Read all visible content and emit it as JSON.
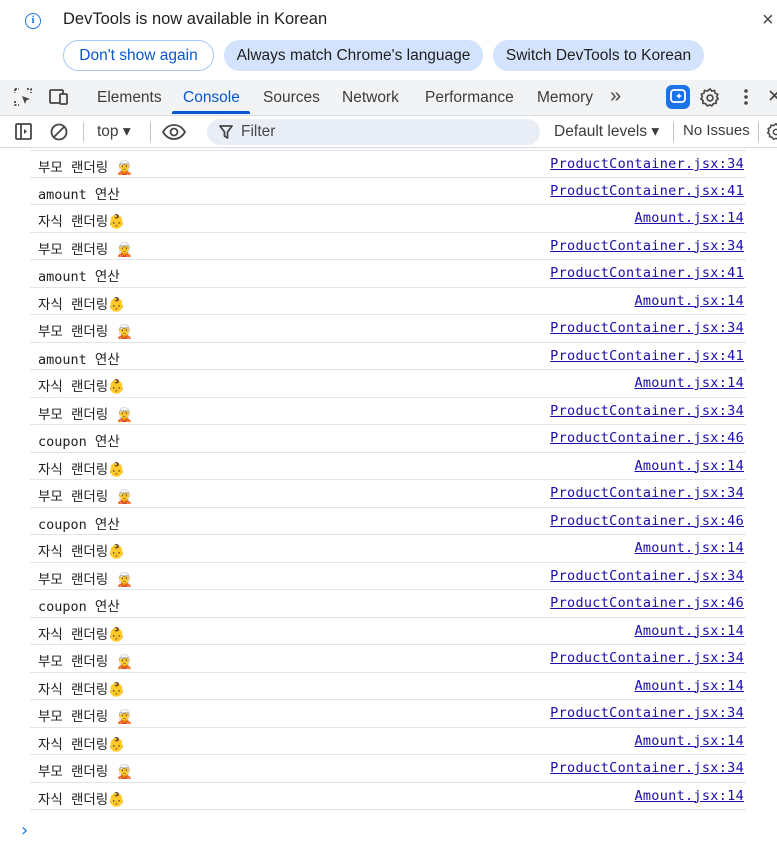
{
  "infobar": {
    "message": "DevTools is now available in Korean",
    "close_glyph": "×",
    "buttons": [
      "Don't show again",
      "Always match Chrome's language",
      "Switch DevTools to Korean"
    ]
  },
  "tabs": {
    "items": [
      "Elements",
      "Console",
      "Sources",
      "Network",
      "Performance",
      "Memory"
    ],
    "active": "Console",
    "more_glyph": "»"
  },
  "toolbar": {
    "context": "top ▾",
    "filter_placeholder": "Filter",
    "levels": "Default levels ▾",
    "issues": "No Issues"
  },
  "console": {
    "rows": [
      {
        "message": "부모 랜더링 🧝",
        "source": "ProductContainer.jsx:34"
      },
      {
        "message": "amount 연산",
        "source": "ProductContainer.jsx:41"
      },
      {
        "message": "자식 랜더링👶",
        "source": "Amount.jsx:14"
      },
      {
        "message": "부모 랜더링 🧝",
        "source": "ProductContainer.jsx:34"
      },
      {
        "message": "amount 연산",
        "source": "ProductContainer.jsx:41"
      },
      {
        "message": "자식 랜더링👶",
        "source": "Amount.jsx:14"
      },
      {
        "message": "부모 랜더링 🧝",
        "source": "ProductContainer.jsx:34"
      },
      {
        "message": "amount 연산",
        "source": "ProductContainer.jsx:41"
      },
      {
        "message": "자식 랜더링👶",
        "source": "Amount.jsx:14"
      },
      {
        "message": "부모 랜더링 🧝",
        "source": "ProductContainer.jsx:34"
      },
      {
        "message": "coupon 연산",
        "source": "ProductContainer.jsx:46"
      },
      {
        "message": "자식 랜더링👶",
        "source": "Amount.jsx:14"
      },
      {
        "message": "부모 랜더링 🧝",
        "source": "ProductContainer.jsx:34"
      },
      {
        "message": "coupon 연산",
        "source": "ProductContainer.jsx:46"
      },
      {
        "message": "자식 랜더링👶",
        "source": "Amount.jsx:14"
      },
      {
        "message": "부모 랜더링 🧝",
        "source": "ProductContainer.jsx:34"
      },
      {
        "message": "coupon 연산",
        "source": "ProductContainer.jsx:46"
      },
      {
        "message": "자식 랜더링👶",
        "source": "Amount.jsx:14"
      },
      {
        "message": "부모 랜더링 🧝",
        "source": "ProductContainer.jsx:34"
      },
      {
        "message": "자식 랜더링👶",
        "source": "Amount.jsx:14"
      },
      {
        "message": "부모 랜더링 🧝",
        "source": "ProductContainer.jsx:34"
      },
      {
        "message": "자식 랜더링👶",
        "source": "Amount.jsx:14"
      },
      {
        "message": "부모 랜더링 🧝",
        "source": "ProductContainer.jsx:34"
      },
      {
        "message": "자식 랜더링👶",
        "source": "Amount.jsx:14"
      }
    ],
    "prompt_glyph": "›"
  },
  "colors": {
    "accent": "#0b57d0",
    "link": "#1a0dab",
    "info": "#1a73e8",
    "pill_filled": "#d3e3fd"
  }
}
